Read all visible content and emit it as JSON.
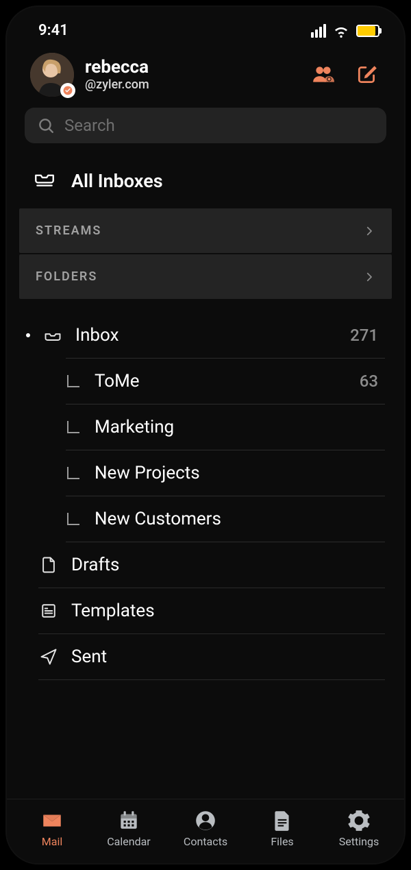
{
  "status": {
    "time": "9:41"
  },
  "profile": {
    "name": "rebecca",
    "handle": "@zyler.com"
  },
  "search": {
    "placeholder": "Search"
  },
  "nav": {
    "all_inboxes": "All Inboxes",
    "sections": {
      "streams": "Streams",
      "folders": "Folders"
    }
  },
  "folders": {
    "inbox": {
      "label": "Inbox",
      "count": "271"
    },
    "sub": [
      {
        "label": "ToMe",
        "count": "63"
      },
      {
        "label": "Marketing",
        "count": ""
      },
      {
        "label": "New Projects",
        "count": ""
      },
      {
        "label": "New Customers",
        "count": ""
      }
    ],
    "drafts": "Drafts",
    "templates": "Templates",
    "sent": "Sent"
  },
  "tabs": {
    "mail": "Mail",
    "calendar": "Calendar",
    "contacts": "Contacts",
    "files": "Files",
    "settings": "Settings"
  },
  "colors": {
    "accent": "#ef845d",
    "battery": "#ffcc00"
  }
}
